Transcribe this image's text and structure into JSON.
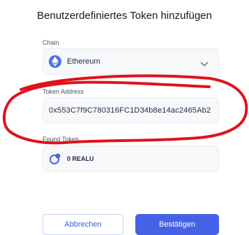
{
  "dialog": {
    "title": "Benutzerdefiniertes Token hinzufügen"
  },
  "chain": {
    "label": "Chain",
    "value": "Ethereum",
    "icon": "ethereum-icon"
  },
  "token_address": {
    "label": "Token Address",
    "value": "0x553C7f9C780316FC1D34b8e14ac2465Ab2"
  },
  "found_token": {
    "label": "Found Token",
    "value": "0 REALU",
    "icon": "token-icon"
  },
  "actions": {
    "cancel_label": "Abbrechen",
    "confirm_label": "Bestätigen"
  },
  "colors": {
    "accent": "#4562e7",
    "annotation": "#e0121c"
  }
}
